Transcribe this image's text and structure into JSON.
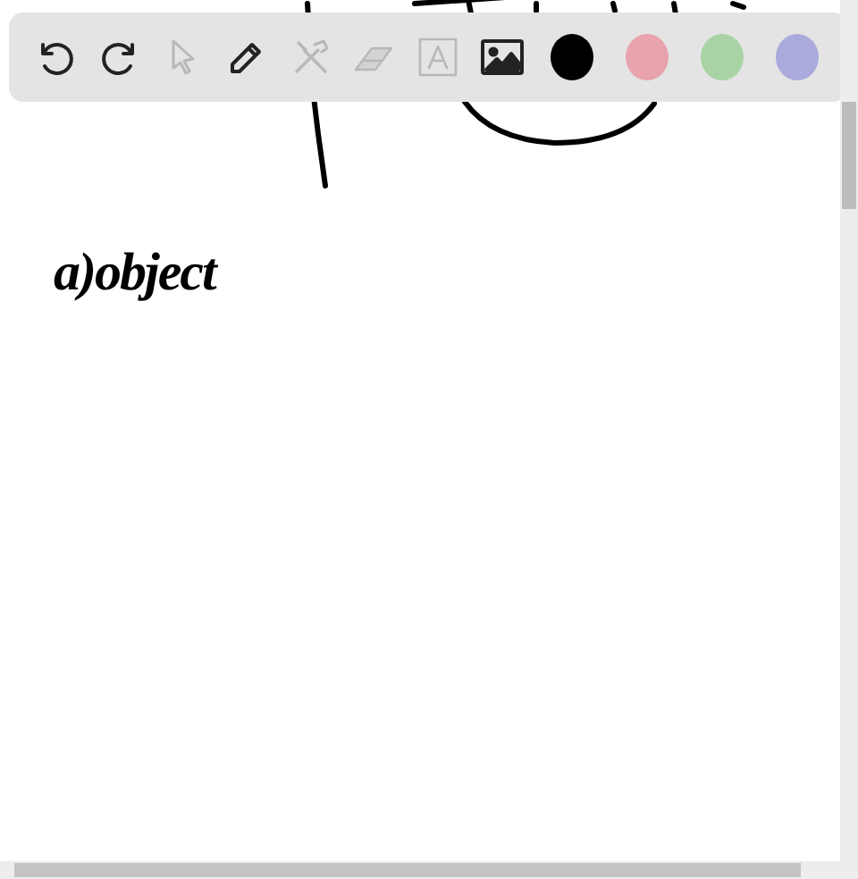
{
  "toolbar": {
    "tools": [
      {
        "kind": "undo",
        "disabled": false
      },
      {
        "kind": "redo",
        "disabled": false
      },
      {
        "kind": "select",
        "disabled": true
      },
      {
        "kind": "pen",
        "disabled": false
      },
      {
        "kind": "tools",
        "disabled": true
      },
      {
        "kind": "eraser",
        "disabled": true
      },
      {
        "kind": "text",
        "disabled": true
      },
      {
        "kind": "image",
        "disabled": false
      }
    ],
    "colors": [
      {
        "color": "#000000"
      },
      {
        "color": "#e8a3ad"
      },
      {
        "color": "#a9d3a5"
      },
      {
        "color": "#aaaadd"
      }
    ]
  },
  "canvas": {
    "note": "a)object"
  }
}
